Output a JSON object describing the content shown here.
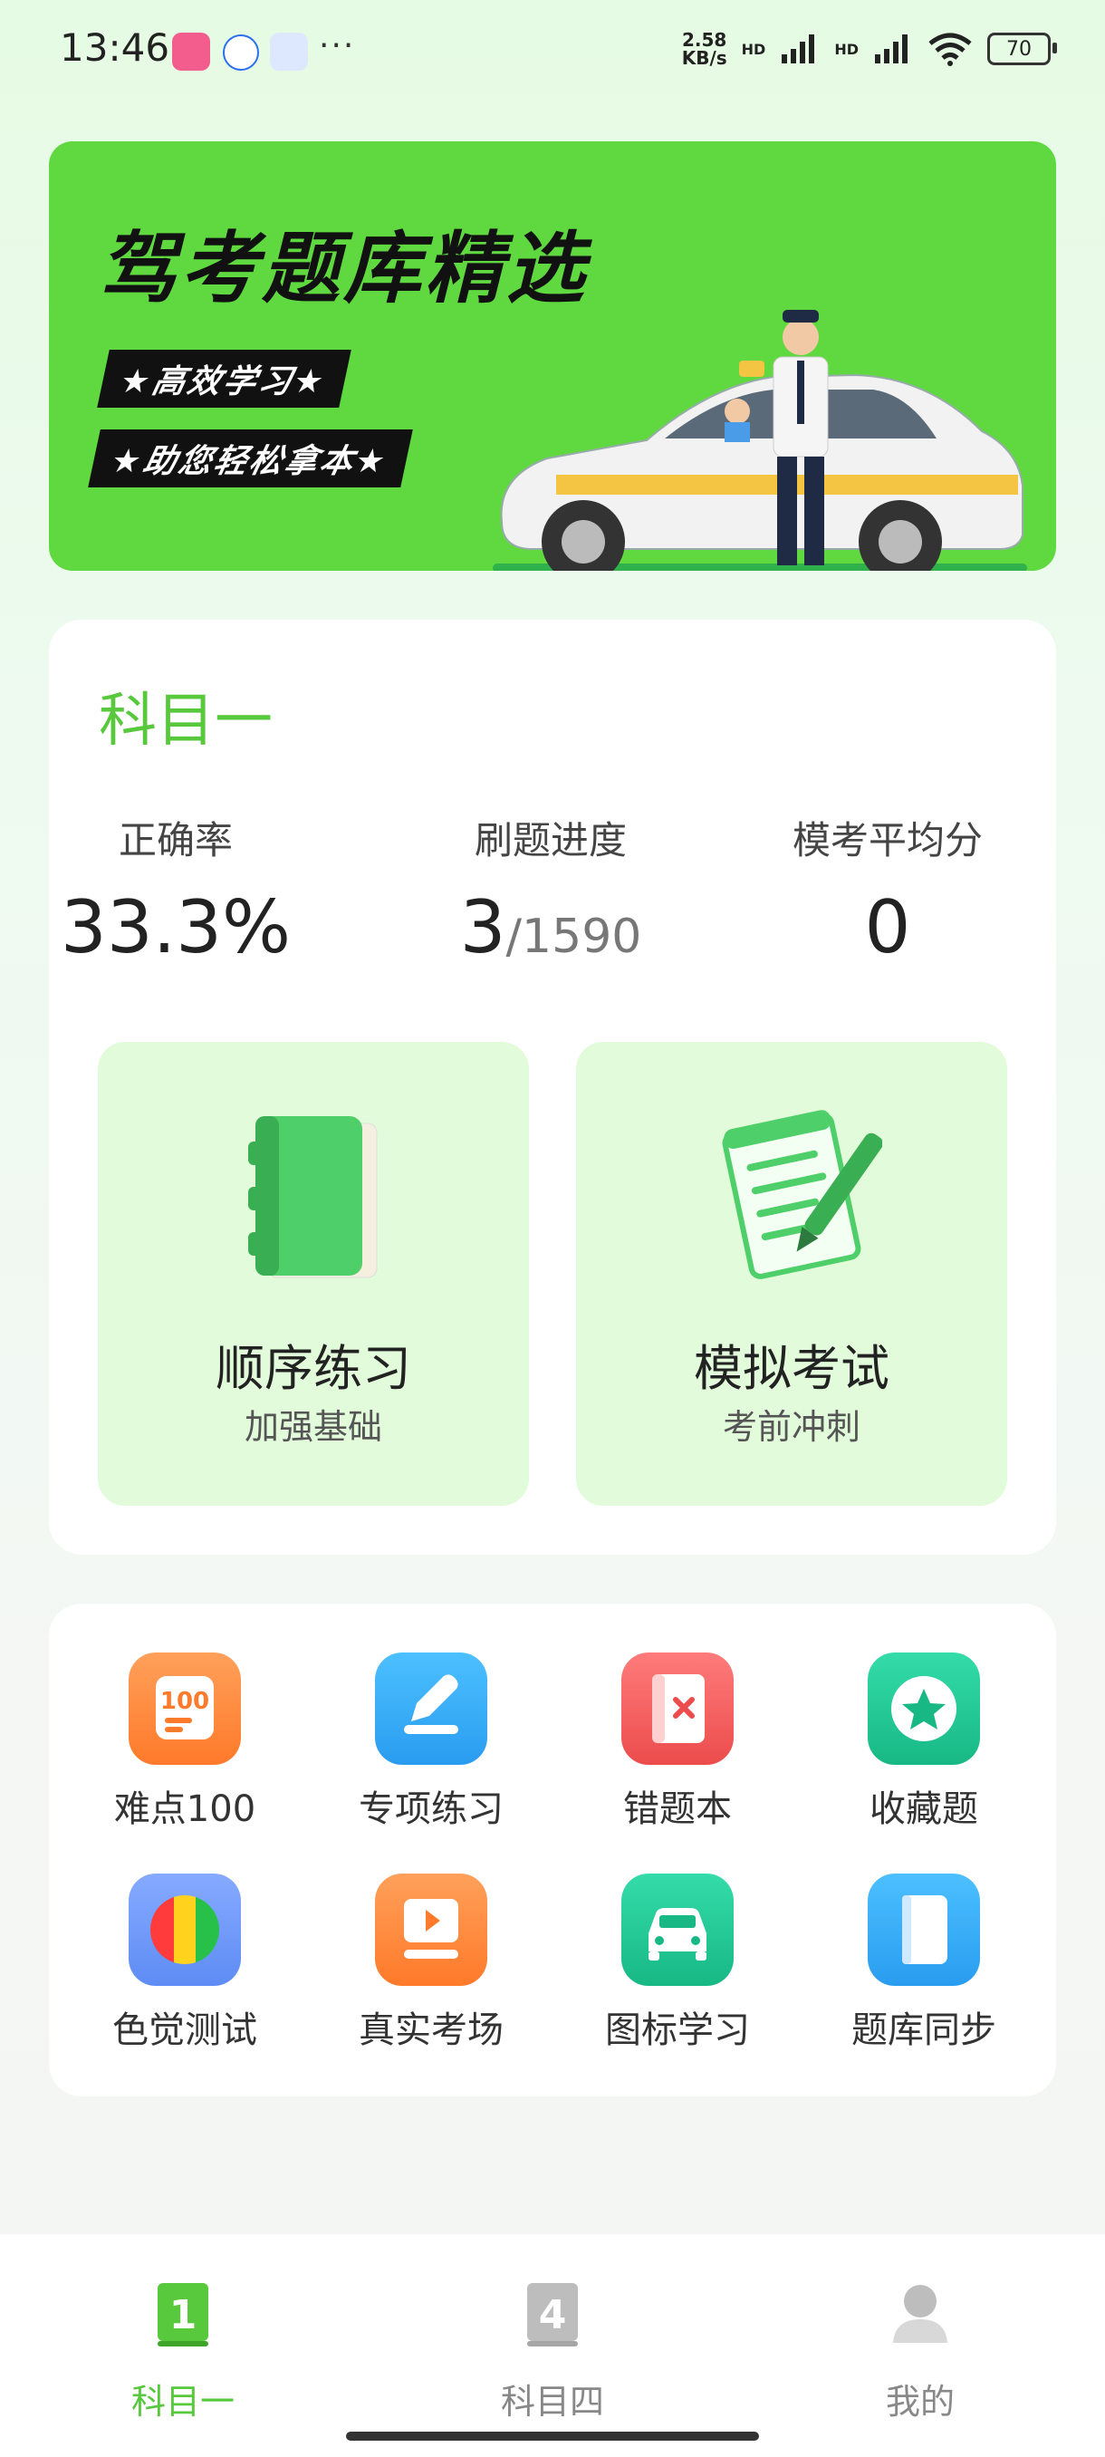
{
  "status_bar": {
    "time": "13:46",
    "net_speed_value": "2.58",
    "net_speed_unit": "KB/s",
    "hd1": "HD",
    "hd2": "HD",
    "battery": "70",
    "more": "···"
  },
  "banner": {
    "title": "驾考题库精选",
    "tag1": "★高效学习★",
    "tag2": "★助您轻松拿本★"
  },
  "subject": {
    "title": "科目一",
    "stats": {
      "accuracy_label": "正确率",
      "accuracy_value": "33.3%",
      "progress_label": "刷题进度",
      "progress_done": "3",
      "progress_total": "/1590",
      "avg_label": "模考平均分",
      "avg_value": "0"
    },
    "tiles": [
      {
        "title": "顺序练习",
        "subtitle": "加强基础"
      },
      {
        "title": "模拟考试",
        "subtitle": "考前冲刺"
      }
    ]
  },
  "tools": [
    {
      "label": "难点100",
      "icon": "hundred-icon",
      "color": "#ff8a3d"
    },
    {
      "label": "专项练习",
      "icon": "edit-icon",
      "color": "#3aaaf5"
    },
    {
      "label": "错题本",
      "icon": "wrong-book-icon",
      "color": "#f25a5a"
    },
    {
      "label": "收藏题",
      "icon": "star-icon",
      "color": "#22c996"
    },
    {
      "label": "色觉测试",
      "icon": "color-test-icon",
      "color": "#6f9cf7"
    },
    {
      "label": "真实考场",
      "icon": "video-icon",
      "color": "#ff8a3d"
    },
    {
      "label": "图标学习",
      "icon": "car-icon",
      "color": "#22c996"
    },
    {
      "label": "题库同步",
      "icon": "sync-icon",
      "color": "#3aaaf5"
    }
  ],
  "nav": [
    {
      "label": "科目一",
      "icon": "subject-one-icon",
      "active": true
    },
    {
      "label": "科目四",
      "icon": "subject-four-icon",
      "active": false
    },
    {
      "label": "我的",
      "icon": "profile-icon",
      "active": false
    }
  ],
  "colors": {
    "accent": "#58c83d",
    "banner": "#5fd93f",
    "tile": "#e2fbdb"
  }
}
